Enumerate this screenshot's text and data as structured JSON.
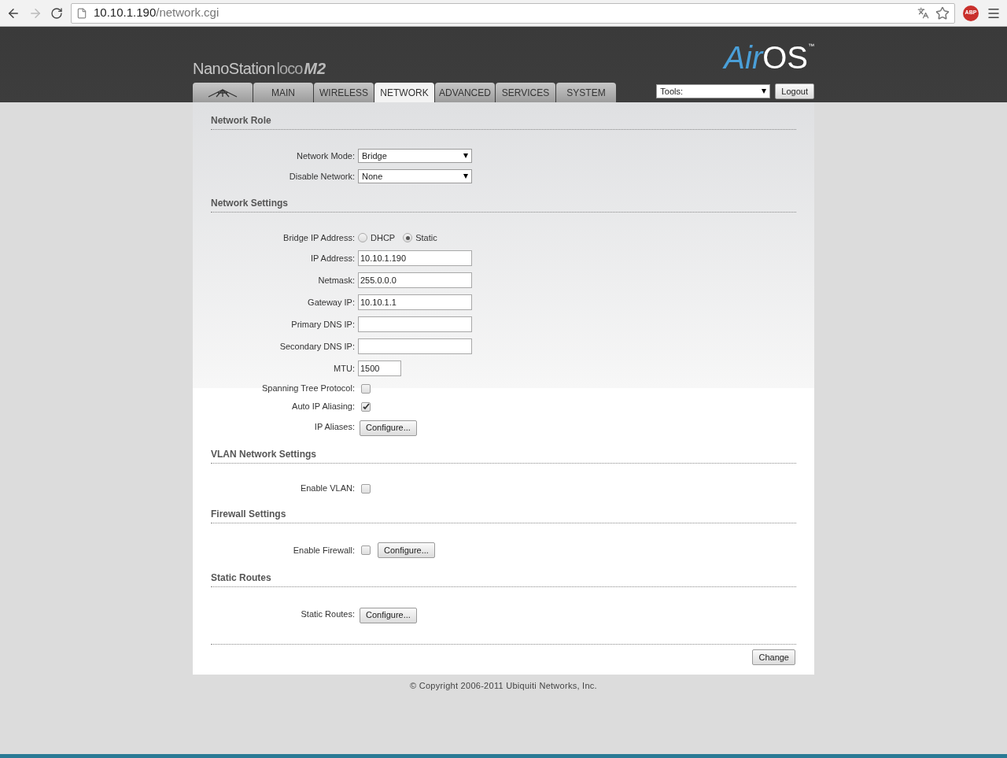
{
  "browser": {
    "url_host": "10.10.1.190",
    "url_path": "/network.cgi",
    "extension_badge": "ABP"
  },
  "header": {
    "product": "NanoStation",
    "variant": "loco",
    "model": "M2",
    "brand_a": "Air",
    "brand_b": "OS",
    "trademark": "™"
  },
  "tabs": [
    {
      "kind": "logo",
      "selected": false
    },
    {
      "kind": "text",
      "label": "MAIN",
      "selected": false
    },
    {
      "kind": "text",
      "label": "WIRELESS",
      "selected": false
    },
    {
      "kind": "text",
      "label": "NETWORK",
      "selected": true
    },
    {
      "kind": "text",
      "label": "ADVANCED",
      "selected": false
    },
    {
      "kind": "text",
      "label": "SERVICES",
      "selected": false
    },
    {
      "kind": "text",
      "label": "SYSTEM",
      "selected": false
    }
  ],
  "tools": {
    "value": "Tools:",
    "logout": "Logout"
  },
  "sections": [
    {
      "title": "Network Role",
      "rows": [
        {
          "kind": "select",
          "label": "Network Mode:",
          "value": "Bridge"
        },
        {
          "kind": "select",
          "label": "Disable Network:",
          "value": "None"
        }
      ]
    },
    {
      "title": "Network Settings",
      "rows": [
        {
          "kind": "radio",
          "label": "Bridge IP Address:",
          "options": [
            {
              "label": "DHCP",
              "selected": false
            },
            {
              "label": "Static",
              "selected": true
            }
          ]
        },
        {
          "kind": "text",
          "label": "IP Address:",
          "value": "10.10.1.190"
        },
        {
          "kind": "text",
          "label": "Netmask:",
          "value": "255.0.0.0"
        },
        {
          "kind": "text",
          "label": "Gateway IP:",
          "value": "10.10.1.1"
        },
        {
          "kind": "text",
          "label": "Primary DNS IP:"
        },
        {
          "kind": "text",
          "label": "Secondary DNS IP:"
        },
        {
          "kind": "short",
          "label": "MTU:",
          "value": "1500"
        },
        {
          "kind": "checkbox",
          "label": "Spanning Tree Protocol:",
          "checked": false
        },
        {
          "kind": "checkbox",
          "label": "Auto IP Aliasing:",
          "checked": true
        },
        {
          "kind": "button",
          "label": "IP Aliases:",
          "button": "Configure..."
        }
      ]
    },
    {
      "title": "VLAN Network Settings",
      "rows": [
        {
          "kind": "checkbox",
          "label": "Enable VLAN:",
          "checked": false
        }
      ]
    },
    {
      "title": "Firewall Settings",
      "rows": [
        {
          "kind": "checkbox_button",
          "label": "Enable Firewall:",
          "checked": false,
          "button": "Configure..."
        }
      ]
    },
    {
      "title": "Static Routes",
      "rows": [
        {
          "kind": "button",
          "label": "Static Routes:",
          "button": "Configure..."
        }
      ]
    }
  ],
  "change_button": "Change",
  "footer": "© Copyright 2006-2011 Ubiquiti Networks, Inc."
}
